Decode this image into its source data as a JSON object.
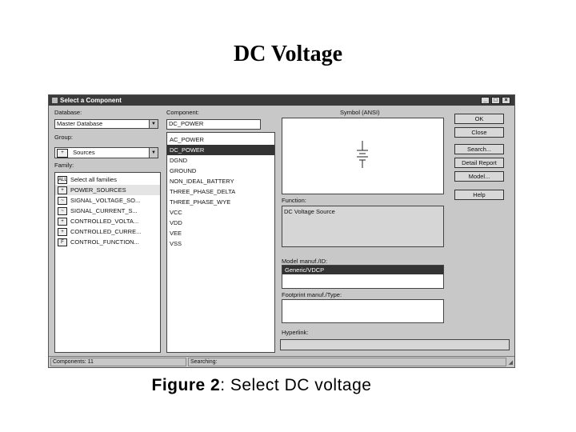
{
  "slide": {
    "title": "DC Voltage",
    "caption_label": "Figure 2",
    "caption_text": ": Select DC voltage"
  },
  "dialog": {
    "title": "Select a Component",
    "database_label": "Database:",
    "database_value": "Master Database",
    "group_label": "Group:",
    "group_value": "Sources",
    "family_label": "Family:",
    "families": [
      {
        "icon": "ALL",
        "label": "Select all families"
      },
      {
        "icon": "+",
        "label": "POWER_SOURCES"
      },
      {
        "icon": "~",
        "label": "SIGNAL_VOLTAGE_SO..."
      },
      {
        "icon": "~",
        "label": "SIGNAL_CURRENT_S..."
      },
      {
        "icon": "+",
        "label": "CONTROLLED_VOLTA..."
      },
      {
        "icon": "+",
        "label": "CONTROLLED_CURRE..."
      },
      {
        "icon": "F",
        "label": "CONTROL_FUNCTION..."
      }
    ],
    "component_label": "Component:",
    "component_value": "DC_POWER",
    "components": [
      "AC_POWER",
      "DC_POWER",
      "DGND",
      "GROUND",
      "NON_IDEAL_BATTERY",
      "THREE_PHASE_DELTA",
      "THREE_PHASE_WYE",
      "VCC",
      "VDD",
      "VEE",
      "VSS"
    ],
    "symbol_label": "Symbol (ANSI)",
    "function_label": "Function:",
    "function_value": "DC Voltage Source",
    "model_label": "Model manuf./ID:",
    "model_value": "Generic/VDCP",
    "footprint_label": "Footprint manuf./Type:",
    "hyperlink_label": "Hyperlink:",
    "buttons": {
      "ok": "OK",
      "close": "Close",
      "search": "Search...",
      "detail_report": "Detail Report",
      "model": "Model...",
      "help": "Help"
    },
    "status_components": "Components: 11",
    "status_searching": "Searching:"
  }
}
